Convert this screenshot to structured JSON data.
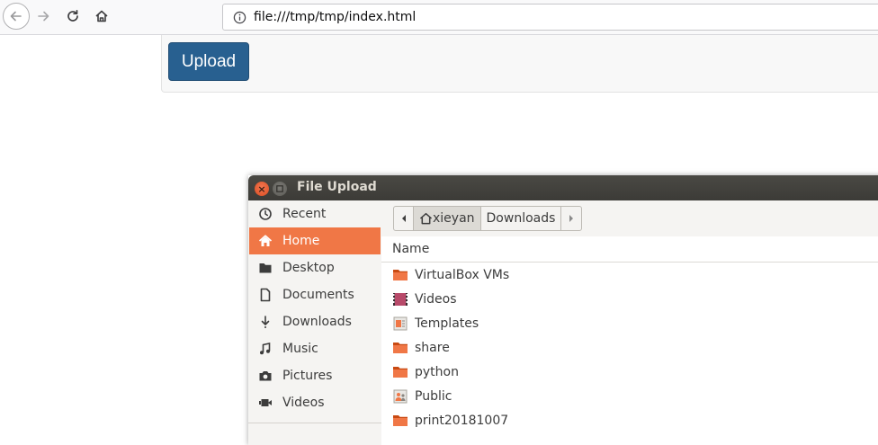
{
  "browser": {
    "url": "file:///tmp/tmp/index.html"
  },
  "page": {
    "upload_label": "Upload"
  },
  "dialog": {
    "title": "File Upload",
    "places": [
      {
        "label": "Recent",
        "icon": "clock-icon"
      },
      {
        "label": "Home",
        "icon": "home-icon",
        "active": true
      },
      {
        "label": "Desktop",
        "icon": "desktop-folder-icon"
      },
      {
        "label": "Documents",
        "icon": "document-icon"
      },
      {
        "label": "Downloads",
        "icon": "download-icon"
      },
      {
        "label": "Music",
        "icon": "music-note-icon"
      },
      {
        "label": "Pictures",
        "icon": "camera-icon"
      },
      {
        "label": "Videos",
        "icon": "video-camera-icon"
      }
    ],
    "breadcrumb": {
      "home": "xieyan",
      "current": "Downloads"
    },
    "list": {
      "header": "Name",
      "files": [
        {
          "name": "VirtualBox VMs",
          "icon": "folder-icon"
        },
        {
          "name": "Videos",
          "icon": "videos-folder-icon"
        },
        {
          "name": "Templates",
          "icon": "templates-folder-icon"
        },
        {
          "name": "share",
          "icon": "folder-icon"
        },
        {
          "name": "python",
          "icon": "folder-icon"
        },
        {
          "name": "Public",
          "icon": "public-folder-icon"
        },
        {
          "name": "print20181007",
          "icon": "folder-icon"
        }
      ]
    },
    "colors": {
      "accent": "#f07746",
      "titlebar": "#3c3b37",
      "folder": "#e95420"
    }
  }
}
